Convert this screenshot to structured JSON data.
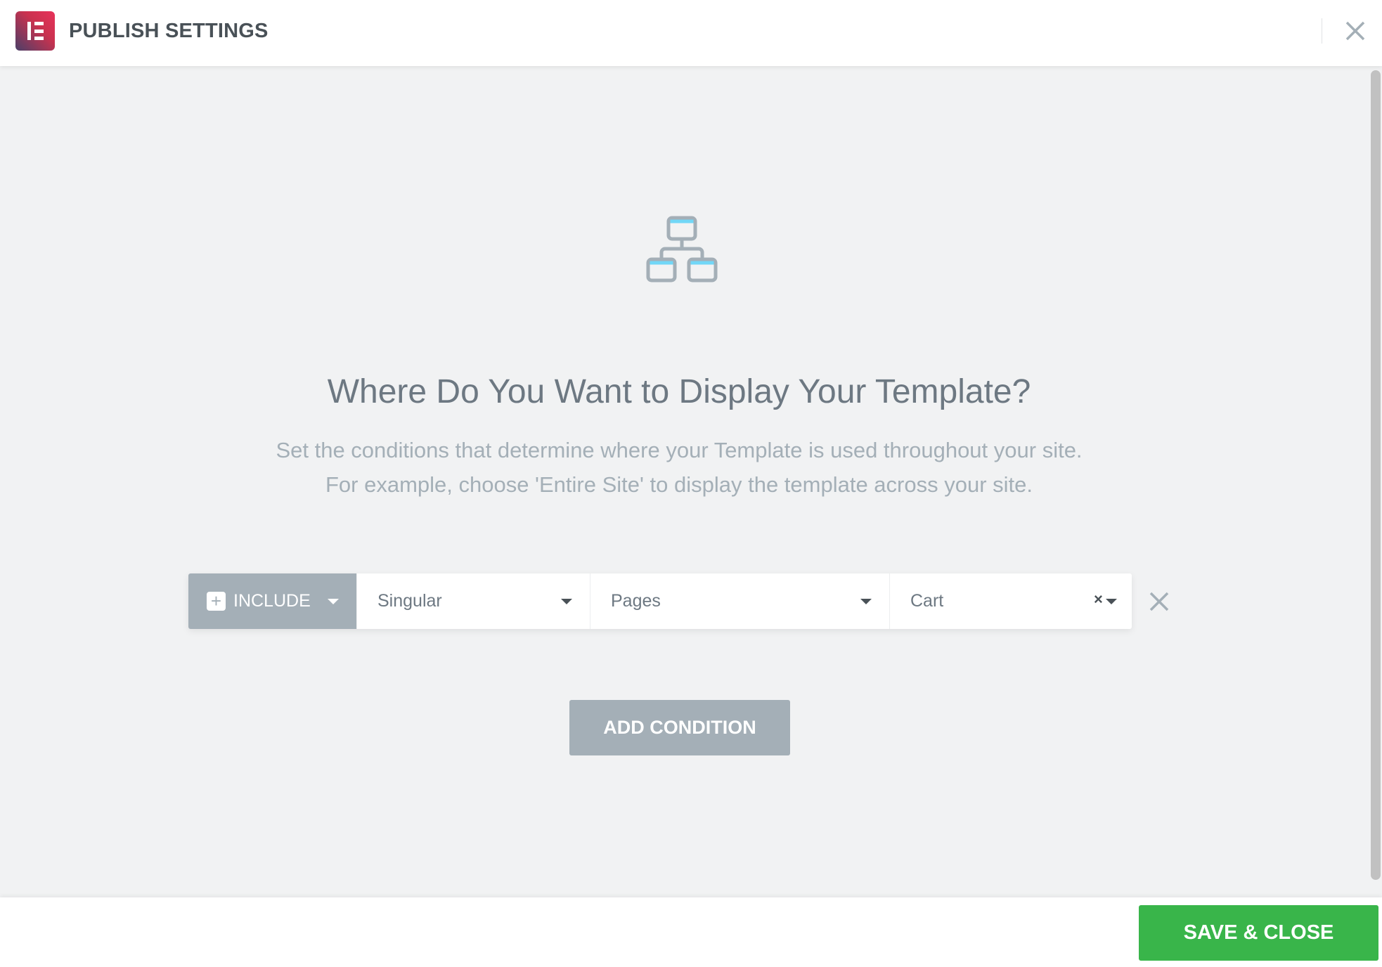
{
  "header": {
    "title": "PUBLISH SETTINGS",
    "logo_icon": "elementor-logo",
    "close_icon": "close-icon"
  },
  "main": {
    "icon": "sitemap-icon",
    "heading": "Where Do You Want to Display Your Template?",
    "description_line1": "Set the conditions that determine where your Template is used throughout your site.",
    "description_line2": "For example, choose 'Entire Site' to display the template across your site.",
    "condition": {
      "type": "INCLUDE",
      "scope": "Singular",
      "subtype": "Pages",
      "item": "Cart",
      "clear_label": "×"
    },
    "add_condition_label": "ADD CONDITION"
  },
  "footer": {
    "save_label": "SAVE & CLOSE"
  },
  "colors": {
    "accent": "#39b54a",
    "muted": "#a4afb7",
    "text": "#495157",
    "brand_start": "#4b3f68",
    "brand_end": "#e8325a"
  }
}
